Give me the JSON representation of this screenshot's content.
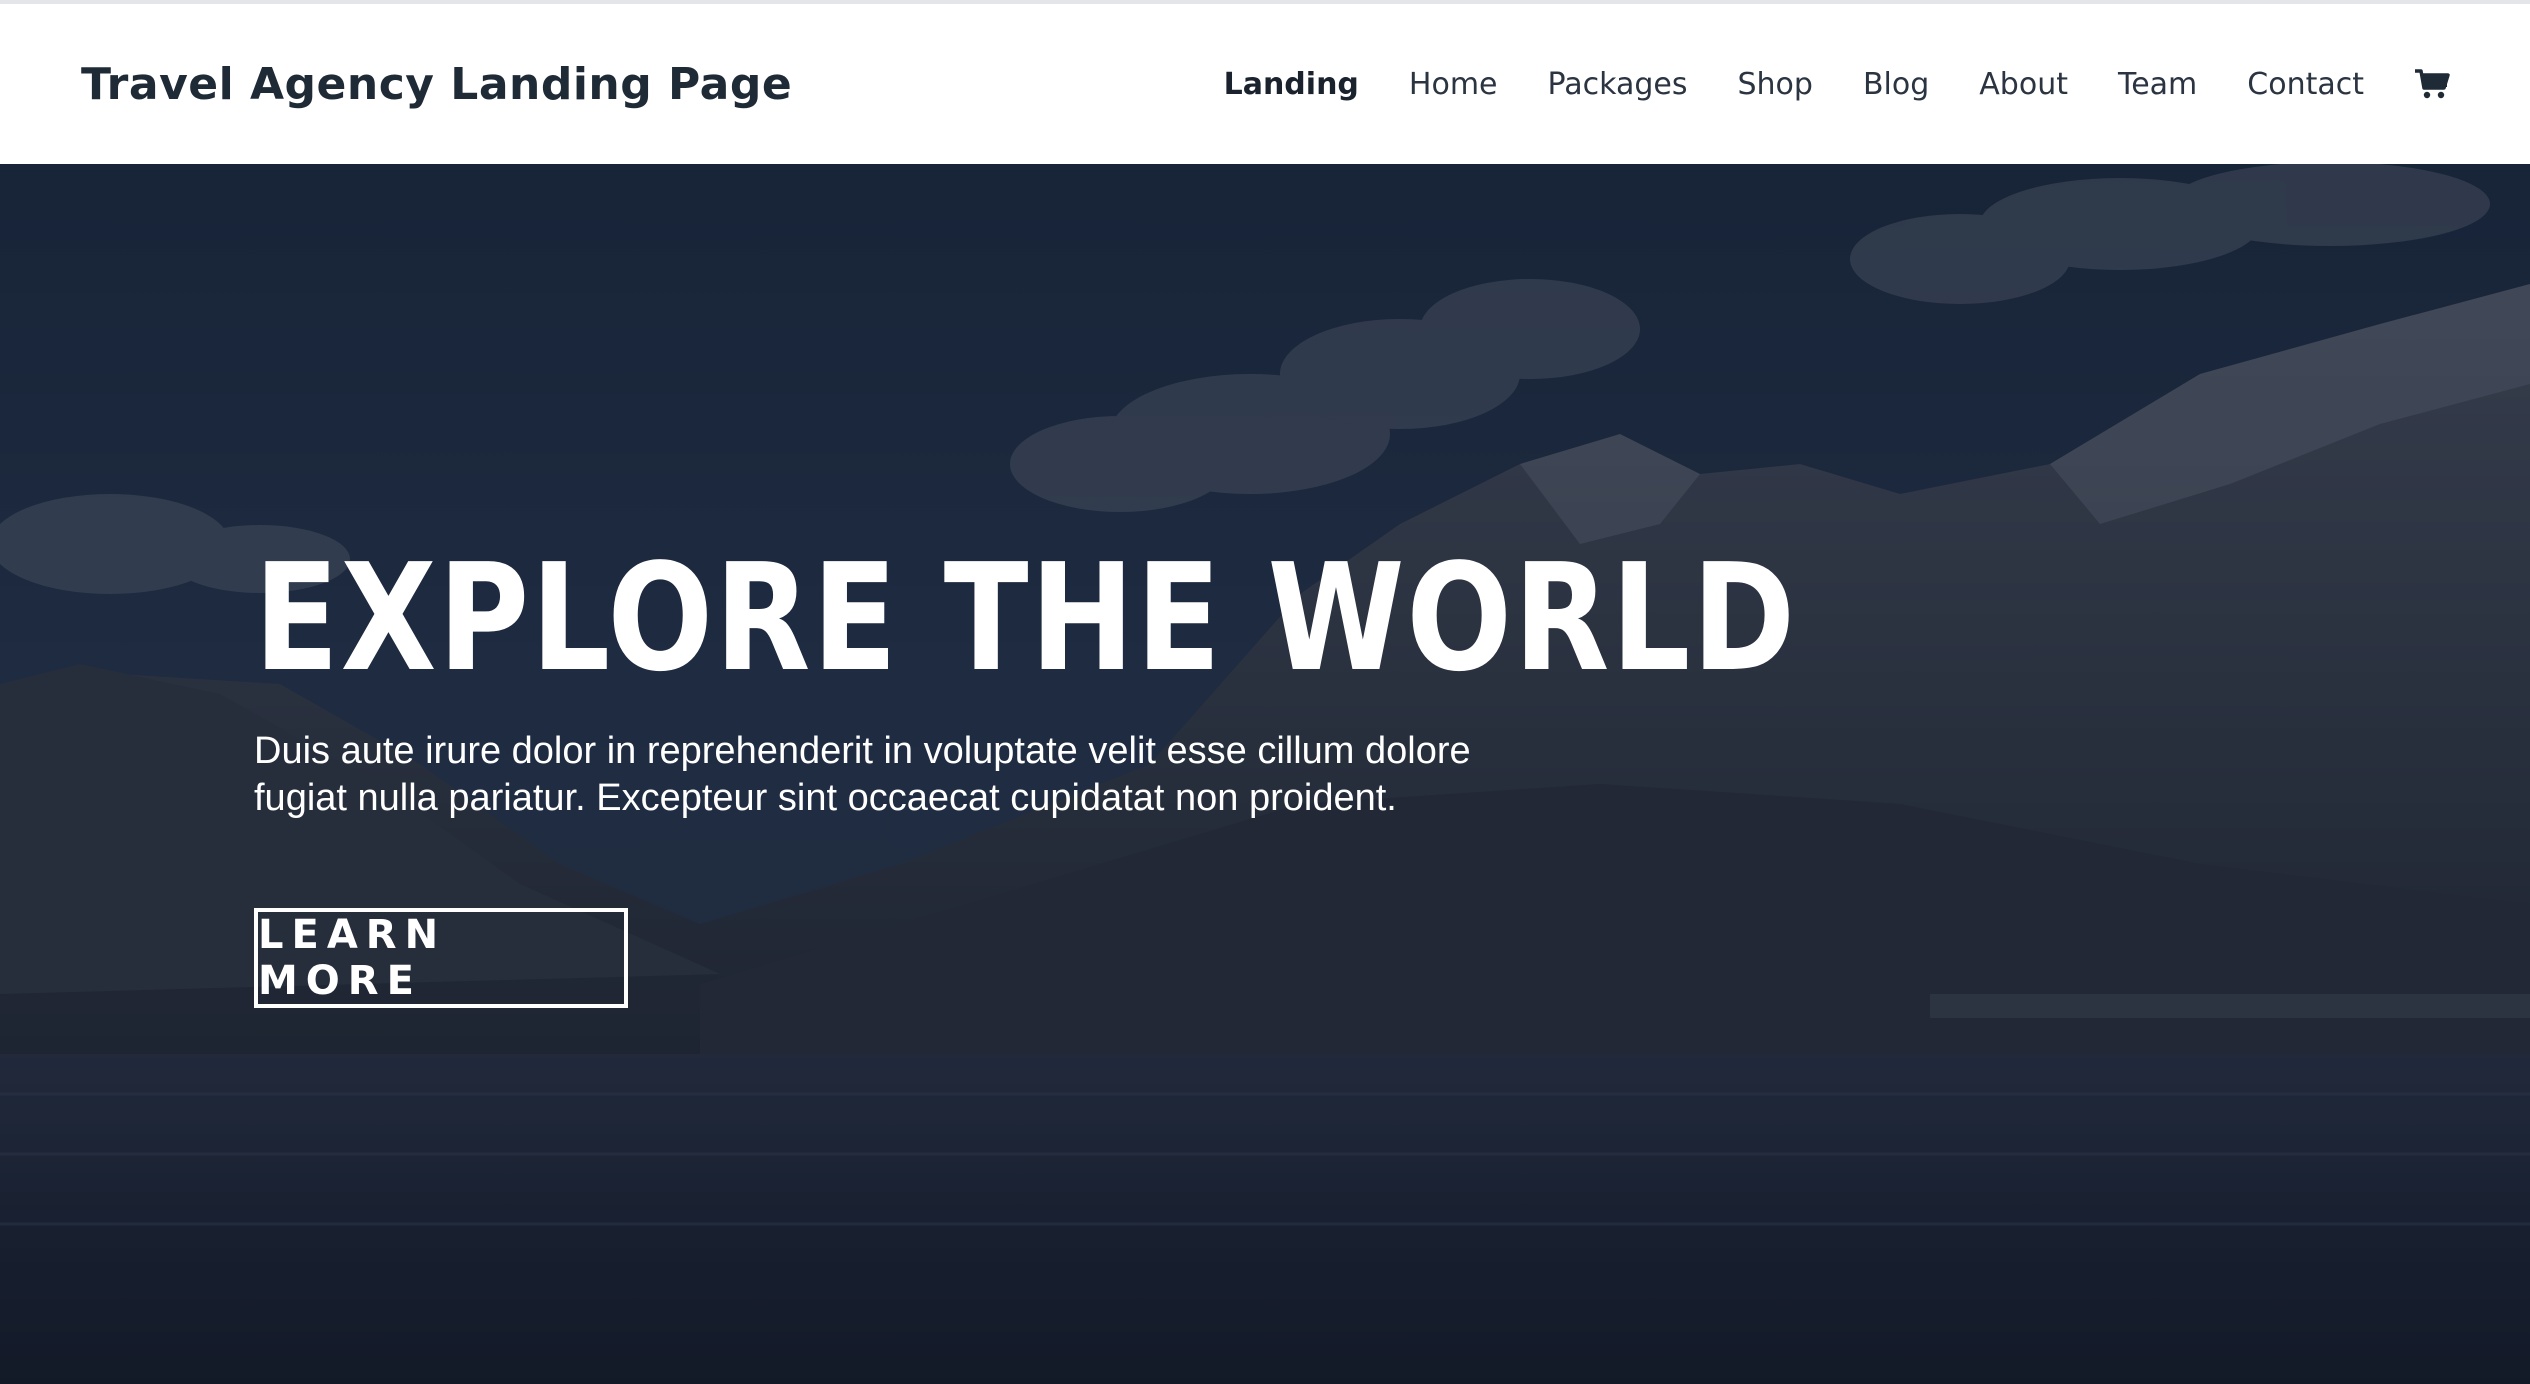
{
  "header": {
    "site_title": "Travel Agency Landing Page",
    "nav": [
      {
        "label": "Landing",
        "active": true
      },
      {
        "label": "Home"
      },
      {
        "label": "Packages"
      },
      {
        "label": "Shop"
      },
      {
        "label": "Blog"
      },
      {
        "label": "About"
      },
      {
        "label": "Team"
      },
      {
        "label": "Contact"
      }
    ],
    "cart_icon": "shopping-cart-icon"
  },
  "hero": {
    "title": "EXPLORE THE WORLD",
    "text": "Duis aute irure dolor in reprehenderit in voluptate velit esse cillum dolore fugiat nulla pariatur. Excepteur sint occaecat cupidatat non proident.",
    "button_label": "LEARN MORE",
    "background_image": "mountain-lake-landscape-photo"
  },
  "colors": {
    "title_text": "#1f2a37",
    "nav_text": "#2b3441",
    "hero_overlay": "#1b2433",
    "hero_text": "#ffffff"
  }
}
